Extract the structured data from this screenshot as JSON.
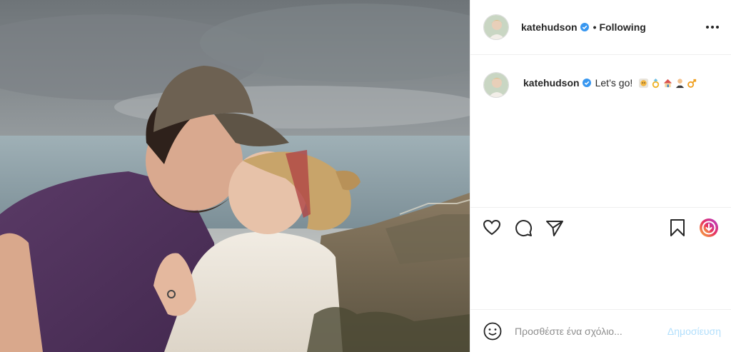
{
  "post": {
    "username": "katehudson",
    "follow_status": "Following",
    "caption_text": "Let’s go!",
    "caption_emojis": [
      "woman-with-veil-emoji",
      "ring-emoji",
      "house-emoji",
      "man-in-tuxedo-emoji",
      "male-sign-emoji"
    ]
  },
  "add_comment": {
    "placeholder": "Προσθέστε ένα σχόλιο...",
    "post_label": "Δημοσίευση"
  },
  "colors": {
    "text": "#262626",
    "verified": "#3897f0",
    "post_button_disabled": "#b2dffc",
    "border": "#efefef"
  },
  "icons": [
    "verified-icon",
    "more-options-icon",
    "heart-icon",
    "comment-icon",
    "share-icon",
    "bookmark-icon",
    "boomerang-icon",
    "emoji-smile-icon"
  ]
}
